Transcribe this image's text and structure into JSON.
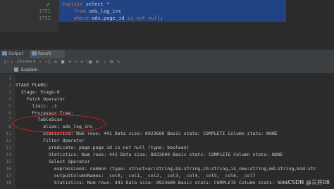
{
  "editor": {
    "lines": [
      {
        "num": "",
        "parts": [
          {
            "t": "explain ",
            "k": true
          },
          {
            "t": "select *",
            "k": false
          }
        ]
      },
      {
        "num": "1751",
        "parts": [
          {
            "t": "    from ",
            "k": true
          },
          {
            "t": "ods_log_inc",
            "k": false
          }
        ]
      },
      {
        "num": "1752",
        "parts": [
          {
            "t": "    where ",
            "k": true
          },
          {
            "t": "ods",
            "k": false
          },
          {
            "t": ".page_id ",
            "k": false
          },
          {
            "t": "is not null",
            "k": true
          },
          {
            "t": ";",
            "k": false
          }
        ]
      }
    ]
  },
  "tabs": [
    {
      "label": "Output",
      "active": false
    },
    {
      "label": "Result 20",
      "active": true
    }
  ],
  "toolbar": {
    "rows_label": "20 rows"
  },
  "explain": {
    "title": "Explain"
  },
  "plan_lines": [
    {
      "num": "1",
      "text": ""
    },
    {
      "num": "2",
      "text": "STAGE PLANS:"
    },
    {
      "num": "3",
      "text": "  Stage: Stage-0"
    },
    {
      "num": "4",
      "text": "    Fetch Operator"
    },
    {
      "num": "5",
      "text": "      limit: -1"
    },
    {
      "num": "6",
      "text": "      Processor Tree:"
    },
    {
      "num": "7",
      "text": "        TableScan"
    },
    {
      "num": "8",
      "text": "          alias: ods_log_inc"
    },
    {
      "num": "11",
      "text": "          Statistics: Num rows: 441 Data size: 8923600 Basic stats: COMPLETE Column stats: NONE"
    },
    {
      "num": "12",
      "text": "          Filter Operator"
    },
    {
      "num": "13",
      "text": "            predicate: page.page_id is not null (type: boolean)"
    },
    {
      "num": "14",
      "text": "            Statistics: Num rows: 441 Data size: 8923600 Basic stats: COMPLETE Column stats: NONE"
    },
    {
      "num": "15",
      "text": "            Select Operator"
    },
    {
      "num": "16",
      "text": "              expressions: common (type: struct<ar:string,ba:string,ch:string,is_new:string,md:string,mid:str"
    },
    {
      "num": "17",
      "text": "              outputColumnNames: _col0, _col1, _col2, _col3, _col4, _col5, _col6, _col7"
    },
    {
      "num": "18",
      "text": "              Statistics: Num rows: 441 Data size: 8923600 Basic stats: COMPLETE Column stats: NONE"
    }
  ],
  "watermark": "CSDN @三井08",
  "colors": {
    "selection": "#214283",
    "annotation": "#e02020"
  }
}
